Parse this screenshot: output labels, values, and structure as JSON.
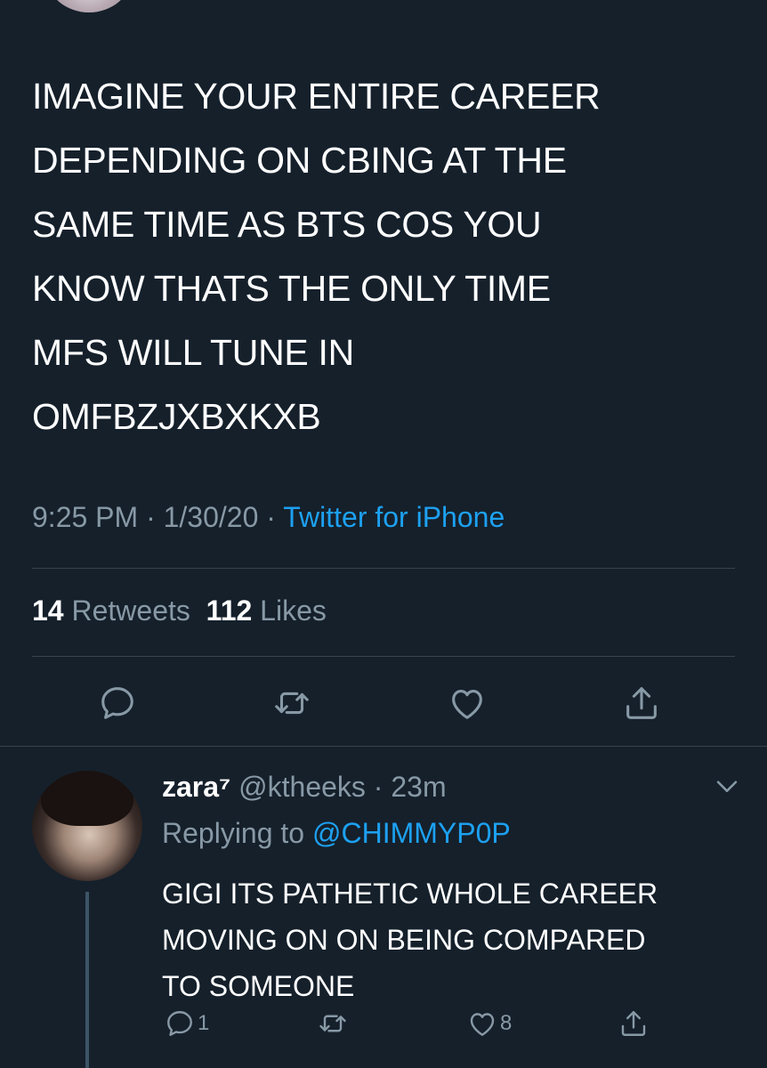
{
  "tweet": {
    "text": "IMAGINE YOUR ENTIRE CAREER\nDEPENDING ON CBING AT THE\nSAME TIME AS BTS COS YOU\nKNOW THATS THE ONLY TIME\nMFS WILL TUNE IN\nOMFBZJXBXKXB",
    "time": "9:25 PM",
    "date": "1/30/20",
    "separator": " · ",
    "source": "Twitter for iPhone",
    "retweets_count": "14",
    "retweets_label": "Retweets",
    "likes_count": "112",
    "likes_label": "Likes",
    "actions": [
      {
        "icon": "reply-icon"
      },
      {
        "icon": "retweet-icon"
      },
      {
        "icon": "like-icon"
      },
      {
        "icon": "share-icon"
      }
    ]
  },
  "reply": {
    "display_name": "zara⁷",
    "handle": "@ktheeks",
    "separator": " · ",
    "time_ago": "23m",
    "replying_label": "Replying to ",
    "replying_to": "@CHIMMYP0P",
    "text": "GIGI ITS PATHETIC WHOLE CAREER\nMOVING ON ON BEING COMPARED\nTO SOMEONE",
    "reply_count": "1",
    "retweet_count": "",
    "like_count": "8"
  },
  "colors": {
    "background": "#15202b",
    "text_primary": "#ffffff",
    "text_secondary": "#8899a6",
    "accent": "#1da1f2",
    "divider": "#38444d"
  }
}
